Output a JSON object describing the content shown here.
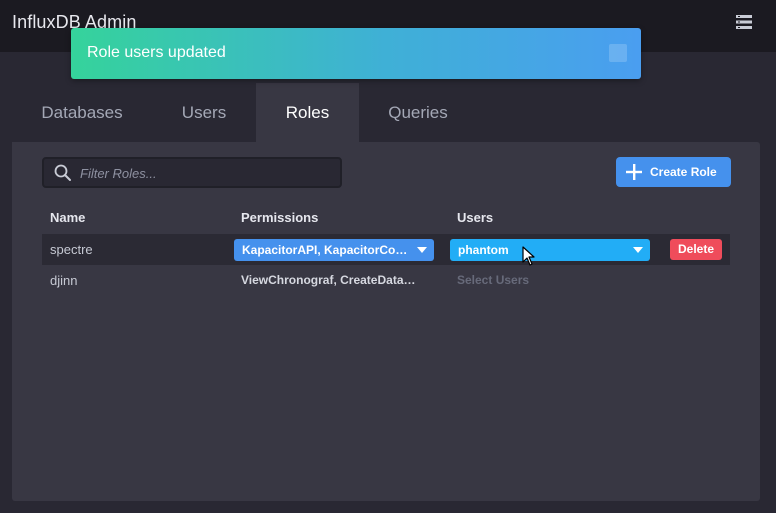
{
  "header": {
    "app_title": "InfluxDB Admin",
    "menu_icon": "list-menu-icon"
  },
  "toast": {
    "message": "Role users updated",
    "close_icon": "close-icon",
    "gradient_start": "#35d39b",
    "gradient_end": "#4a9ef0"
  },
  "tabs": [
    {
      "label": "Databases",
      "active": false
    },
    {
      "label": "Users",
      "active": false
    },
    {
      "label": "Roles",
      "active": true
    },
    {
      "label": "Queries",
      "active": false
    }
  ],
  "roles": {
    "filter_placeholder": "Filter Roles...",
    "filter_value": "",
    "create_label": "Create Role",
    "columns": {
      "name": "Name",
      "permissions": "Permissions",
      "users": "Users"
    },
    "rows": [
      {
        "name": "spectre",
        "permissions": "KapacitorAPI, KapacitorConfigAPI",
        "users": "phantom",
        "delete_label": "Delete",
        "editing": true
      },
      {
        "name": "djinn",
        "permissions": "ViewChronograf, CreateDatabase",
        "users": "Select Users",
        "editing": false
      }
    ]
  },
  "colors": {
    "accent_blue": "#4591ed",
    "users_dropdown": "#22adf6",
    "danger": "#ef4c5b",
    "panel": "#383743",
    "background": "#292833"
  }
}
